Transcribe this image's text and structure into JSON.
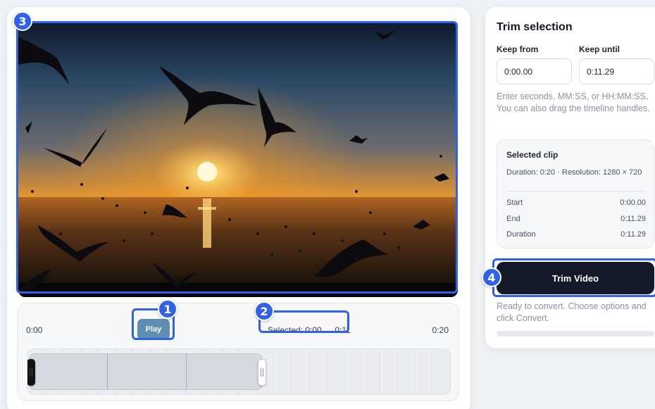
{
  "player": {
    "play_label": "Play",
    "time_start": "0:00",
    "time_end": "0:20",
    "selected_readout": "Selected: 0:00 → 0:11"
  },
  "trim": {
    "title": "Trim selection",
    "keep_from_label": "Keep from",
    "keep_until_label": "Keep until",
    "keep_from_value": "0:00.00",
    "keep_until_value": "0:11.29",
    "hint": "Enter seconds, MM:SS, or HH:MM:SS. You can also drag the timeline handles.",
    "button_label": "Trim Video",
    "status": "Ready to convert. Choose options and click Convert.",
    "progress_fraction": 0
  },
  "clip": {
    "title": "Selected clip",
    "meta": "Duration: 0:20 · Resolution: 1280 × 720",
    "rows": [
      {
        "label": "Start",
        "value": "0:00.00"
      },
      {
        "label": "End",
        "value": "0:11.29"
      },
      {
        "label": "Duration",
        "value": "0:11.29"
      }
    ]
  },
  "annotations": {
    "badge_1": "1",
    "badge_2": "2",
    "badge_3": "3",
    "badge_4": "4",
    "color": "#2f62e8"
  },
  "colors": {
    "play_button": "#5e8fb3",
    "trim_button": "#141a2a",
    "hint_text": "#8a93a3"
  }
}
